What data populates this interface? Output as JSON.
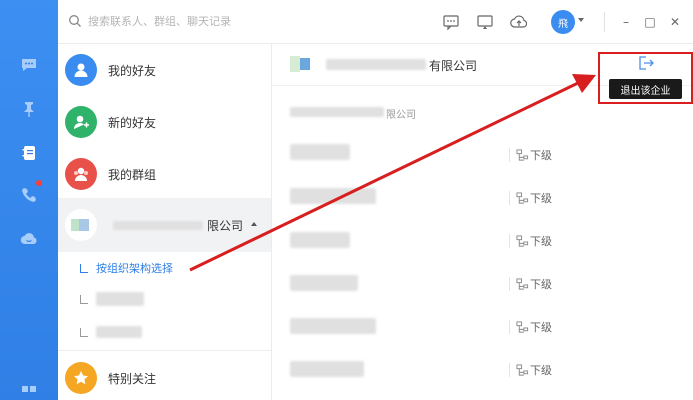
{
  "search": {
    "placeholder": "搜索联系人、群组、聊天记录"
  },
  "user": {
    "avatar_text": "飛"
  },
  "window": {
    "minimize": "–",
    "maximize": "□",
    "close": "✕"
  },
  "rail": {
    "items": [
      {
        "icon": "chat-bubble-icon"
      },
      {
        "icon": "pin-icon"
      },
      {
        "icon": "address-book-icon"
      },
      {
        "icon": "phone-icon",
        "badge": true
      },
      {
        "icon": "cloud-icon"
      },
      {
        "icon": "grid-icon"
      }
    ]
  },
  "contacts": {
    "my_friends": "我的好友",
    "new_friends": "新的好友",
    "my_groups": "我的群组",
    "org_name_suffix": "限公司",
    "org_browse": "按组织架构选择",
    "special_follow": "特别关注"
  },
  "main": {
    "company_title_suffix": "有限公司",
    "dept_suffix": "限公司",
    "exit_tooltip": "退出该企业",
    "sublevel_label": "下级"
  },
  "colors": {
    "rail": "#2f7fe6",
    "accent": "#2f7fe6",
    "friends": "#3b8cf0",
    "new_friends": "#2fb36b",
    "groups": "#e8504a",
    "special": "#f5a623",
    "annotation": "#d81e1e"
  }
}
